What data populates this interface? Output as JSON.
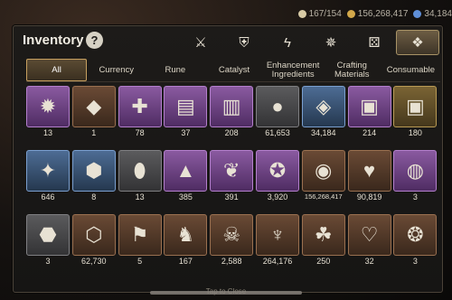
{
  "resources": [
    {
      "value": "167/154",
      "color": "#d8cba6"
    },
    {
      "value": "156,268,417",
      "color": "#d3a84a"
    },
    {
      "value": "34,184",
      "color": "#5f8fd8"
    }
  ],
  "title": "Inventory",
  "help_label": "?",
  "filters": [
    {
      "icon": "sword-shield-icon",
      "glyph": "⚔"
    },
    {
      "icon": "crossed-shield-icon",
      "glyph": "⛨"
    },
    {
      "icon": "lightning-icon",
      "glyph": "ϟ"
    },
    {
      "icon": "figure-icon",
      "glyph": "✵"
    },
    {
      "icon": "dice-icon",
      "glyph": "⚄"
    },
    {
      "icon": "all-items-icon",
      "glyph": "❖"
    }
  ],
  "tabs": [
    {
      "label": "All",
      "active": true
    },
    {
      "label": "Currency"
    },
    {
      "label": "Rune"
    },
    {
      "label": "Catalyst"
    },
    {
      "label": "Enhancement Ingredients"
    },
    {
      "label": "Crafting Materials"
    },
    {
      "label": "Consumable"
    }
  ],
  "items": [
    {
      "icon": "spider-relic-icon",
      "glyph": "✹",
      "count": "13",
      "rarity": "purple"
    },
    {
      "icon": "gold-crystal-icon",
      "glyph": "◆",
      "count": "1",
      "rarity": "brown"
    },
    {
      "icon": "red-sigil-icon",
      "glyph": "✚",
      "count": "78",
      "rarity": "purple"
    },
    {
      "icon": "scroll-bundle-icon",
      "glyph": "▤",
      "count": "37",
      "rarity": "purple"
    },
    {
      "icon": "book-bundle-icon",
      "glyph": "▥",
      "count": "208",
      "rarity": "purple"
    },
    {
      "icon": "silver-egg-icon",
      "glyph": "●",
      "count": "61,653",
      "rarity": "gray"
    },
    {
      "icon": "blue-crystal-icon",
      "glyph": "◈",
      "count": "34,184",
      "rarity": "blue"
    },
    {
      "icon": "purple-card-icon",
      "glyph": "▣",
      "count": "214",
      "rarity": "purple"
    },
    {
      "icon": "gold-card-icon",
      "glyph": "▣",
      "count": "180",
      "rarity": "gold"
    },
    {
      "icon": "star-charm-icon",
      "glyph": "✦",
      "count": "646",
      "rarity": "blue"
    },
    {
      "icon": "green-crystal-icon",
      "glyph": "⬢",
      "count": "8",
      "rarity": "blue"
    },
    {
      "icon": "stone-shard-icon",
      "glyph": "⬮",
      "count": "13",
      "rarity": "gray"
    },
    {
      "icon": "magic-pouch-icon",
      "glyph": "▲",
      "count": "385",
      "rarity": "purple"
    },
    {
      "icon": "leaf-feather-icon",
      "glyph": "❦",
      "count": "391",
      "rarity": "purple"
    },
    {
      "icon": "emblem-icon",
      "glyph": "✪",
      "count": "3,920",
      "rarity": "purple"
    },
    {
      "icon": "gold-coin-icon",
      "glyph": "◉",
      "count": "156,268,417",
      "rarity": "brown"
    },
    {
      "icon": "green-heart-icon",
      "glyph": "♥",
      "count": "90,819",
      "rarity": "brown"
    },
    {
      "icon": "red-orb-icon",
      "glyph": "◍",
      "count": "3",
      "rarity": "purple"
    },
    {
      "icon": "red-gem-plate-icon",
      "glyph": "⬣",
      "count": "3",
      "rarity": "gray"
    },
    {
      "icon": "gold-crest-icon",
      "glyph": "⬡",
      "count": "62,730",
      "rarity": "brown"
    },
    {
      "icon": "banner-icon",
      "glyph": "⚑",
      "count": "5",
      "rarity": "brown"
    },
    {
      "icon": "knight-piece-icon",
      "glyph": "♞",
      "count": "167",
      "rarity": "brown"
    },
    {
      "icon": "skull-mask-icon",
      "glyph": "☠",
      "count": "2,588",
      "rarity": "brown"
    },
    {
      "icon": "demon-mask-icon",
      "glyph": "♆",
      "count": "264,176",
      "rarity": "brown"
    },
    {
      "icon": "clover-icon",
      "glyph": "☘",
      "count": "250",
      "rarity": "brown"
    },
    {
      "icon": "heartbeat-icon",
      "glyph": "♡",
      "count": "32",
      "rarity": "brown"
    },
    {
      "icon": "red-token-icon",
      "glyph": "❂",
      "count": "3",
      "rarity": "brown"
    }
  ],
  "footer_hint": "Tap to Close"
}
